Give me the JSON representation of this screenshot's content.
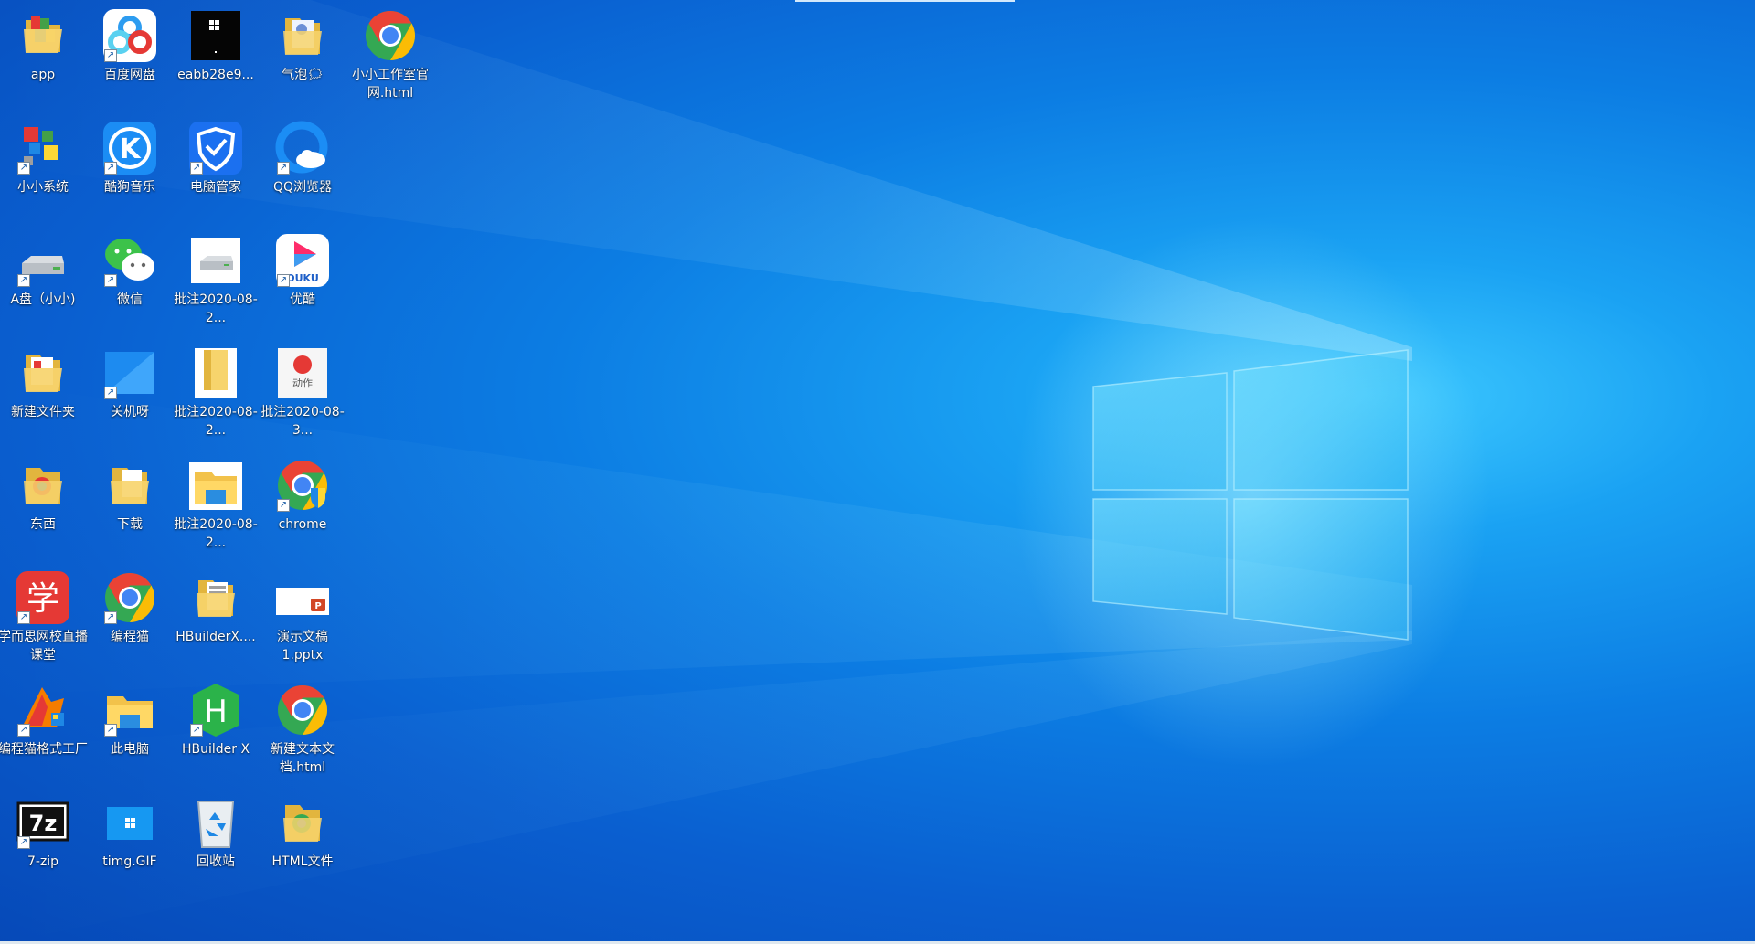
{
  "desktop": {
    "wallpaper": "windows-10-hero-light",
    "accent_color": "#0a7fe3",
    "icons": [
      {
        "id": "app",
        "label": "app",
        "icon": "folder-icon"
      },
      {
        "id": "baidu",
        "label": "百度网盘",
        "icon": "baidu-netdisk-icon"
      },
      {
        "id": "eabb",
        "label": "eabb28e9...",
        "icon": "black-window-thumbnail-icon"
      },
      {
        "id": "qipao",
        "label": "气泡🗯",
        "icon": "folder-icon"
      },
      {
        "id": "xxgzs",
        "label": "小小工作室官网.html",
        "icon": "chrome-icon"
      },
      {
        "id": "xxxt",
        "label": "小小系统",
        "icon": "colorful-grid-icon"
      },
      {
        "id": "kugou",
        "label": "酷狗音乐",
        "icon": "kugou-music-icon"
      },
      {
        "id": "diannao",
        "label": "电脑管家",
        "icon": "shield-icon"
      },
      {
        "id": "qqbrowser",
        "label": "QQ浏览器",
        "icon": "qq-browser-icon"
      },
      {
        "id": "apan",
        "label": "A盘（小小)",
        "icon": "drive-icon"
      },
      {
        "id": "weixin",
        "label": "微信",
        "icon": "wechat-icon"
      },
      {
        "id": "pz1",
        "label": "批注2020-08-2...",
        "icon": "drive-thumbnail-icon"
      },
      {
        "id": "youku",
        "label": "优酷",
        "icon": "youku-icon"
      },
      {
        "id": "newfolder",
        "label": "新建文件夹",
        "icon": "folder-icon"
      },
      {
        "id": "guanji",
        "label": "关机呀",
        "icon": "blue-tile-icon"
      },
      {
        "id": "pz2",
        "label": "批注2020-08-2...",
        "icon": "document-yellow-icon"
      },
      {
        "id": "pz3",
        "label": "批注2020-08-3...",
        "icon": "dongzuo-card-icon"
      },
      {
        "id": "dongxi",
        "label": "东西",
        "icon": "folder-icon"
      },
      {
        "id": "xiazai",
        "label": "下载",
        "icon": "folder-icon"
      },
      {
        "id": "pz4",
        "label": "批注2020-08-2...",
        "icon": "file-explorer-icon"
      },
      {
        "id": "chrome",
        "label": "chrome",
        "icon": "chrome-shield-icon"
      },
      {
        "id": "xueersi",
        "label": "学而思网校直播课堂",
        "icon": "xueersi-icon"
      },
      {
        "id": "biancheng",
        "label": "编程猫",
        "icon": "chrome-icon"
      },
      {
        "id": "hbx_folder",
        "label": "HBuilderX....",
        "icon": "folder-icon"
      },
      {
        "id": "pptx",
        "label": "演示文稿1.pptx",
        "icon": "pptx-icon"
      },
      {
        "id": "gsgc",
        "label": "编程猫格式工厂",
        "icon": "format-factory-icon"
      },
      {
        "id": "thispc",
        "label": "此电脑",
        "icon": "file-explorer-icon"
      },
      {
        "id": "hbx",
        "label": "HBuilder X",
        "icon": "hbuilder-icon"
      },
      {
        "id": "newhtml",
        "label": "新建文本文档.html",
        "icon": "chrome-icon"
      },
      {
        "id": "7zip",
        "label": "7-zip",
        "icon": "seven-zip-icon"
      },
      {
        "id": "timg",
        "label": "timg.GIF",
        "icon": "windows-tile-icon"
      },
      {
        "id": "recycle",
        "label": "回收站",
        "icon": "recycle-bin-icon"
      },
      {
        "id": "htmlfolder",
        "label": "HTML文件",
        "icon": "folder-icon"
      }
    ]
  }
}
